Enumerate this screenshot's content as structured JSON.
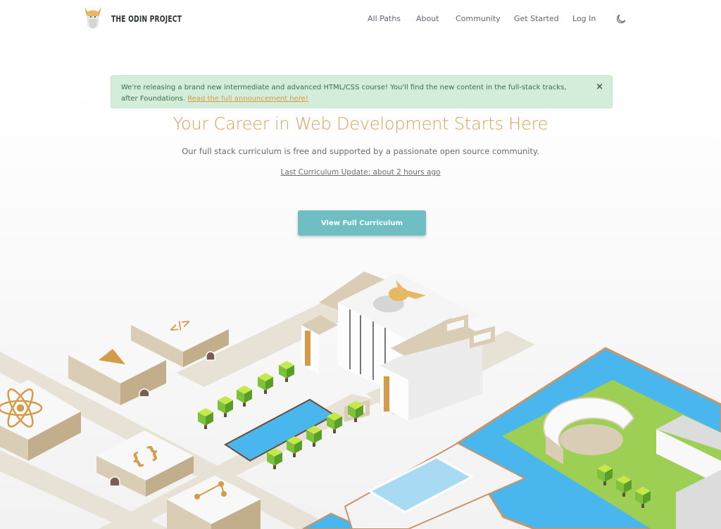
{
  "navbar": {
    "logo_text": "THE ODIN PROJECT",
    "links": [
      {
        "label": "All Paths"
      },
      {
        "label": "About"
      },
      {
        "label": "Community"
      },
      {
        "label": "Get Started"
      },
      {
        "label": "Log In"
      }
    ],
    "theme_toggle_icon": "moon-icon"
  },
  "banner": {
    "message": "We're releasing a brand new intermediate and advanced HTML/CSS course! You'll find the new content in the full-stack tracks, after Foundations.",
    "link_text": "Read the full announcement here!",
    "close_label": "×",
    "background": "#d4edda",
    "link_color": "#d49b48"
  },
  "hero": {
    "title": "Your Career in Web Development Starts Here",
    "subtitle": "Our full stack curriculum is free and supported by a passionate open source community.",
    "last_update": "Last Curriculum Update: about 2 hours ago",
    "cta_label": "View Full Curriculum",
    "title_color": "#d9a25a",
    "cta_color": "#6ebec3"
  },
  "illustration": {
    "description": "Isometric city illustration",
    "building_icons": [
      "code-tag-icon",
      "triangle-gem-icon",
      "atom-icon",
      "curly-braces-icon",
      "git-branch-icon"
    ],
    "colors": {
      "water": "#49b7ee",
      "grass": "#9ccf53",
      "building_top": "#f8f8f8",
      "building_side": "#d9ceb5",
      "accent": "#d49b48"
    }
  }
}
